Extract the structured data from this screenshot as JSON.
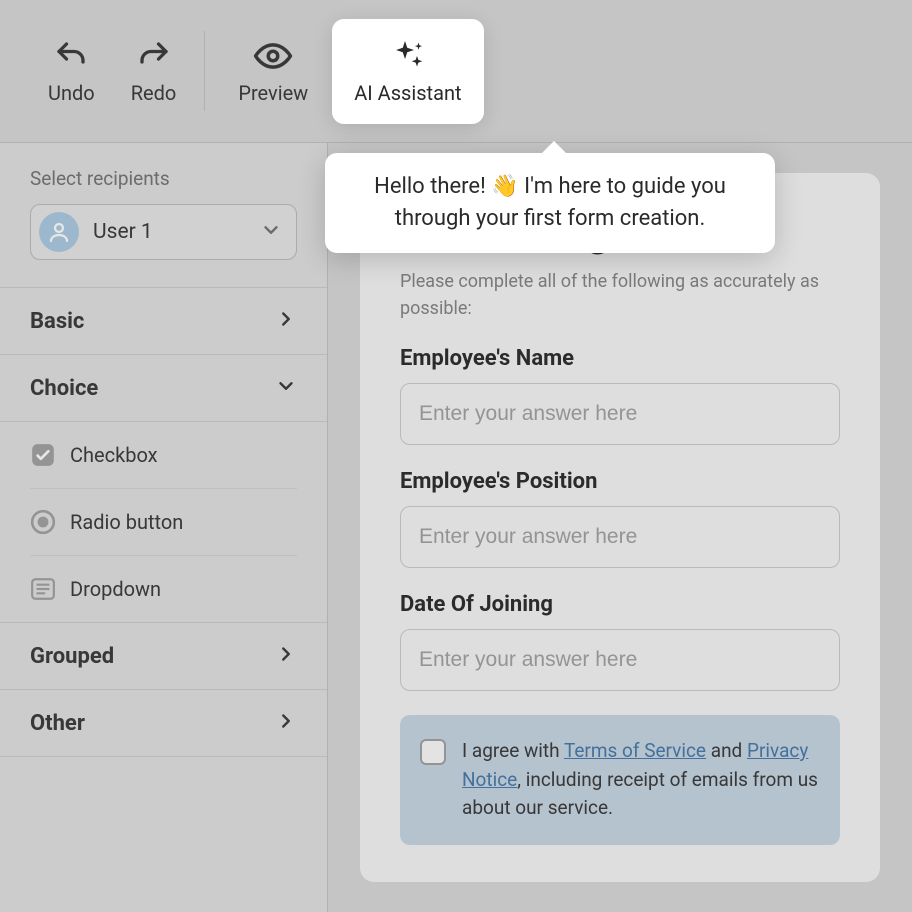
{
  "toolbar": {
    "undo_label": "Undo",
    "redo_label": "Redo",
    "preview_label": "Preview",
    "ai_assistant_label": "AI Assistant"
  },
  "sidebar": {
    "recipients_label": "Select recipients",
    "selected_user": "User 1",
    "categories": {
      "basic": "Basic",
      "choice": "Choice",
      "grouped": "Grouped",
      "other": "Other"
    },
    "choice_items": {
      "checkbox": "Checkbox",
      "radio": "Radio button",
      "dropdown": "Dropdown"
    }
  },
  "tooltip": {
    "text_before": "Hello there! ",
    "emoji": "👋",
    "text_after": " I'm here to guide you through your first form creation."
  },
  "form": {
    "title": "Onboarding",
    "subtitle": "Please complete all of the following as accurately as possible:",
    "fields": {
      "name_label": "Employee's Name",
      "name_placeholder": "Enter your answer here",
      "position_label": "Employee's Position",
      "position_placeholder": "Enter your answer here",
      "date_label": "Date Of Joining",
      "date_placeholder": "Enter your answer here"
    },
    "consent": {
      "prefix": "I agree with ",
      "tos": "Terms of Service",
      "mid": " and ",
      "privacy": "Privacy Notice",
      "suffix": ", including receipt of emails from us about our service."
    }
  }
}
